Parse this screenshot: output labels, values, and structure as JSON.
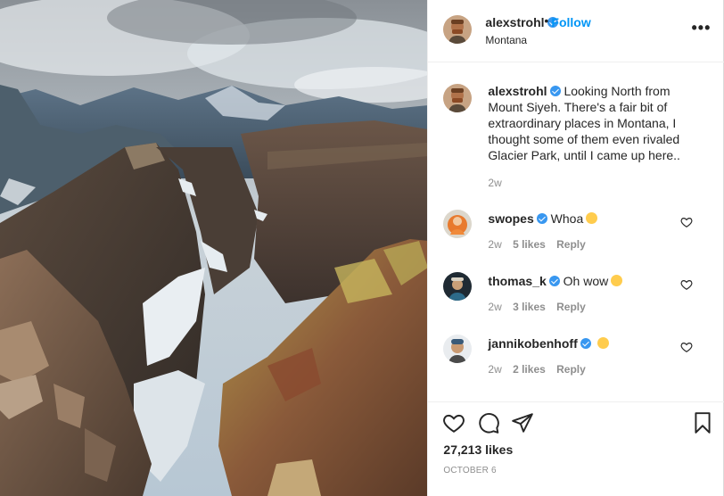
{
  "post": {
    "username": "alexstrohl",
    "location": "Montana",
    "follow_label": "Follow",
    "separator": "•",
    "more_label": "•••"
  },
  "caption": {
    "username": "alexstrohl",
    "text": "Looking North from Mount Siyeh. There's a fair bit of extraordinary places in Montana, I thought some of them even rivaled Glacier Park, until I came up here..",
    "time": "2w"
  },
  "comments": [
    {
      "username": "swopes",
      "text": "Whoa",
      "time": "2w",
      "likes": "5 likes",
      "reply": "Reply",
      "emoji": "rofl-emoji"
    },
    {
      "username": "thomas_k",
      "text": "Oh wow",
      "time": "2w",
      "likes": "3 likes",
      "reply": "Reply",
      "emoji": "heart-eyes-emoji"
    },
    {
      "username": "jannikobenhoff",
      "text": "",
      "time": "2w",
      "likes": "2 likes",
      "reply": "Reply",
      "emoji": "heart-eyes-emoji"
    }
  ],
  "actions": {
    "like_icon": "heart-icon",
    "comment_icon": "comment-icon",
    "share_icon": "share-icon",
    "save_icon": "bookmark-icon"
  },
  "likes_count": "27,213 likes",
  "date": "OCTOBER 6",
  "colors": {
    "link": "#0095f6",
    "verified": "#3897f0",
    "muted": "#8e8e8e",
    "text": "#262626"
  }
}
